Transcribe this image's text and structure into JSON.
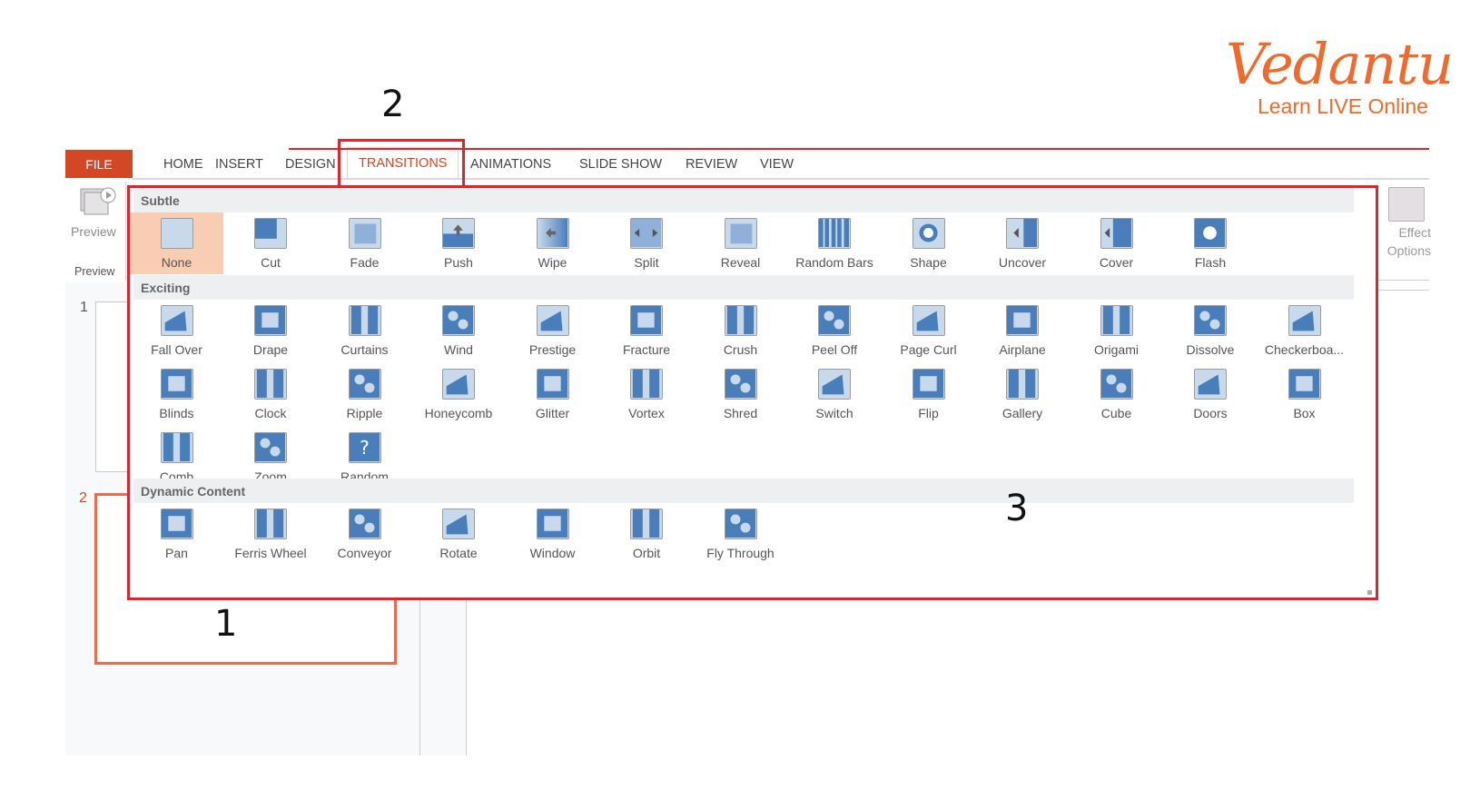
{
  "logo": {
    "brand": "Vedantu",
    "tagline": "Learn LIVE Online",
    "color": "#ef6a2c"
  },
  "ribbon": {
    "file_tab": "FILE",
    "tabs": [
      "HOME",
      "INSERT",
      "DESIGN",
      "TRANSITIONS",
      "ANIMATIONS",
      "SLIDE SHOW",
      "REVIEW",
      "VIEW"
    ],
    "active_tab": "TRANSITIONS",
    "accent_color": "#d24726"
  },
  "preview_group": {
    "button_label": "Preview",
    "group_label": "Preview"
  },
  "effect_options": {
    "line1": "Effect",
    "line2": "Options"
  },
  "slides": {
    "slide1_number": "1",
    "slide2_number": "2"
  },
  "annotations": {
    "one": "1",
    "two": "2",
    "three": "3"
  },
  "gallery": {
    "sections": [
      {
        "title": "Subtle",
        "items": [
          "None",
          "Cut",
          "Fade",
          "Push",
          "Wipe",
          "Split",
          "Reveal",
          "Random Bars",
          "Shape",
          "Uncover",
          "Cover",
          "Flash"
        ]
      },
      {
        "title": "Exciting",
        "items": [
          "Fall Over",
          "Drape",
          "Curtains",
          "Wind",
          "Prestige",
          "Fracture",
          "Crush",
          "Peel Off",
          "Page Curl",
          "Airplane",
          "Origami",
          "Dissolve",
          "Checkerboa...",
          "Blinds",
          "Clock",
          "Ripple",
          "Honeycomb",
          "Glitter",
          "Vortex",
          "Shred",
          "Switch",
          "Flip",
          "Gallery",
          "Cube",
          "Doors",
          "Box",
          "Comb",
          "Zoom",
          "Random"
        ]
      },
      {
        "title": "Dynamic Content",
        "items": [
          "Pan",
          "Ferris Wheel",
          "Conveyor",
          "Rotate",
          "Window",
          "Orbit",
          "Fly Through"
        ]
      }
    ],
    "selected": "None"
  }
}
